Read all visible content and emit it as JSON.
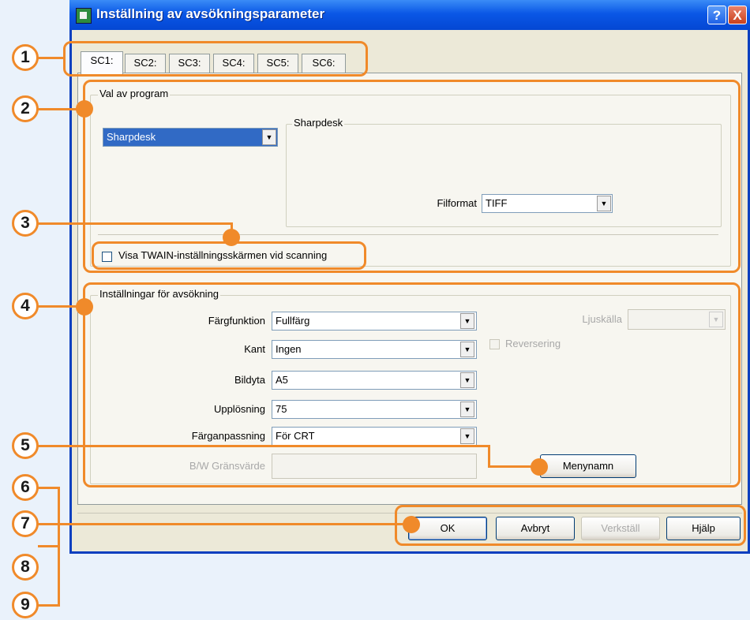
{
  "window": {
    "title": "Inställning av avsökningsparameter",
    "help_glyph": "?",
    "close_glyph": "X"
  },
  "tabs": [
    "SC1:",
    "SC2:",
    "SC3:",
    "SC4:",
    "SC5:",
    "SC6:"
  ],
  "program_group": {
    "label": "Val av program",
    "program_value": "Sharpdesk",
    "sub_group_label": "Sharpdesk",
    "file_format_label": "Filformat",
    "file_format_value": "TIFF",
    "twain_checkbox_label": "Visa TWAIN-inställningsskärmen vid scanning"
  },
  "scan_group": {
    "label": "Inställningar för avsökning",
    "color_mode_label": "Färgfunktion",
    "color_mode_value": "Fullfärg",
    "edge_label": "Kant",
    "edge_value": "Ingen",
    "area_label": "Bildyta",
    "area_value": "A5",
    "resolution_label": "Upplösning",
    "resolution_value": "75",
    "color_match_label": "Färganpassning",
    "color_match_value": "För CRT",
    "bw_threshold_label": "B/W Gränsvärde",
    "bw_threshold_value": "",
    "light_source_label": "Ljuskälla",
    "light_source_value": "",
    "reverse_label": "Reversering",
    "menu_name_button": "Menynamn"
  },
  "buttons": {
    "ok": "OK",
    "cancel": "Avbryt",
    "apply": "Verkställ",
    "help": "Hjälp"
  },
  "callouts": [
    "1",
    "2",
    "3",
    "4",
    "5",
    "6",
    "7",
    "8",
    "9"
  ],
  "colors": {
    "callout": "#f08a2a",
    "titlebar": "#0a57e6",
    "dialog_bg": "#ece9d8",
    "page_bg": "#eaf2fb"
  }
}
